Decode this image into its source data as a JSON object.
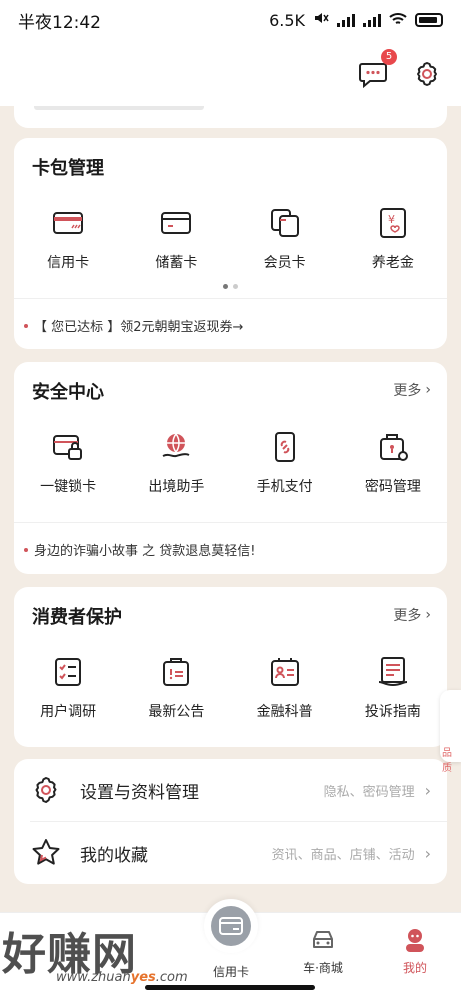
{
  "status_bar": {
    "time": "半夜12:42",
    "net_speed": "6.5K"
  },
  "header": {
    "message_badge": "5"
  },
  "card_pack": {
    "title": "卡包管理",
    "items": [
      {
        "label": "信用卡",
        "icon": "credit-card-icon"
      },
      {
        "label": "储蓄卡",
        "icon": "debit-card-icon"
      },
      {
        "label": "会员卡",
        "icon": "member-card-icon"
      },
      {
        "label": "养老金",
        "icon": "pension-icon"
      }
    ],
    "notice": "【 您已达标 】领2元朝朝宝返现券→"
  },
  "security": {
    "title": "安全中心",
    "more": "更多",
    "items": [
      {
        "label": "一键锁卡",
        "icon": "card-lock-icon"
      },
      {
        "label": "出境助手",
        "icon": "globe-hand-icon"
      },
      {
        "label": "手机支付",
        "icon": "phone-pay-icon"
      },
      {
        "label": "密码管理",
        "icon": "password-icon"
      }
    ],
    "notice": "身边的诈骗小故事 之 贷款退息莫轻信!"
  },
  "consumer": {
    "title": "消费者保护",
    "more": "更多",
    "items": [
      {
        "label": "用户调研",
        "icon": "survey-icon"
      },
      {
        "label": "最新公告",
        "icon": "announcement-icon"
      },
      {
        "label": "金融科普",
        "icon": "finance-edu-icon"
      },
      {
        "label": "投诉指南",
        "icon": "complaint-guide-icon"
      }
    ]
  },
  "settings": {
    "rows": [
      {
        "label": "设置与资料管理",
        "hint": "隐私、密码管理"
      },
      {
        "label": "我的收藏",
        "hint": "资讯、商品、店铺、活动"
      }
    ]
  },
  "tabbar": {
    "tabs": [
      {
        "label": "信用卡"
      },
      {
        "label": "车·商城"
      },
      {
        "label": "我的"
      }
    ]
  },
  "watermark": {
    "text": "好赚网",
    "url_prefix": "www.zhuan",
    "url_highlight": "yes",
    "url_suffix": ".com"
  },
  "float_tab": {
    "label": "品质"
  },
  "colors": {
    "accent": "#d0545a",
    "background": "#f3ece4"
  }
}
